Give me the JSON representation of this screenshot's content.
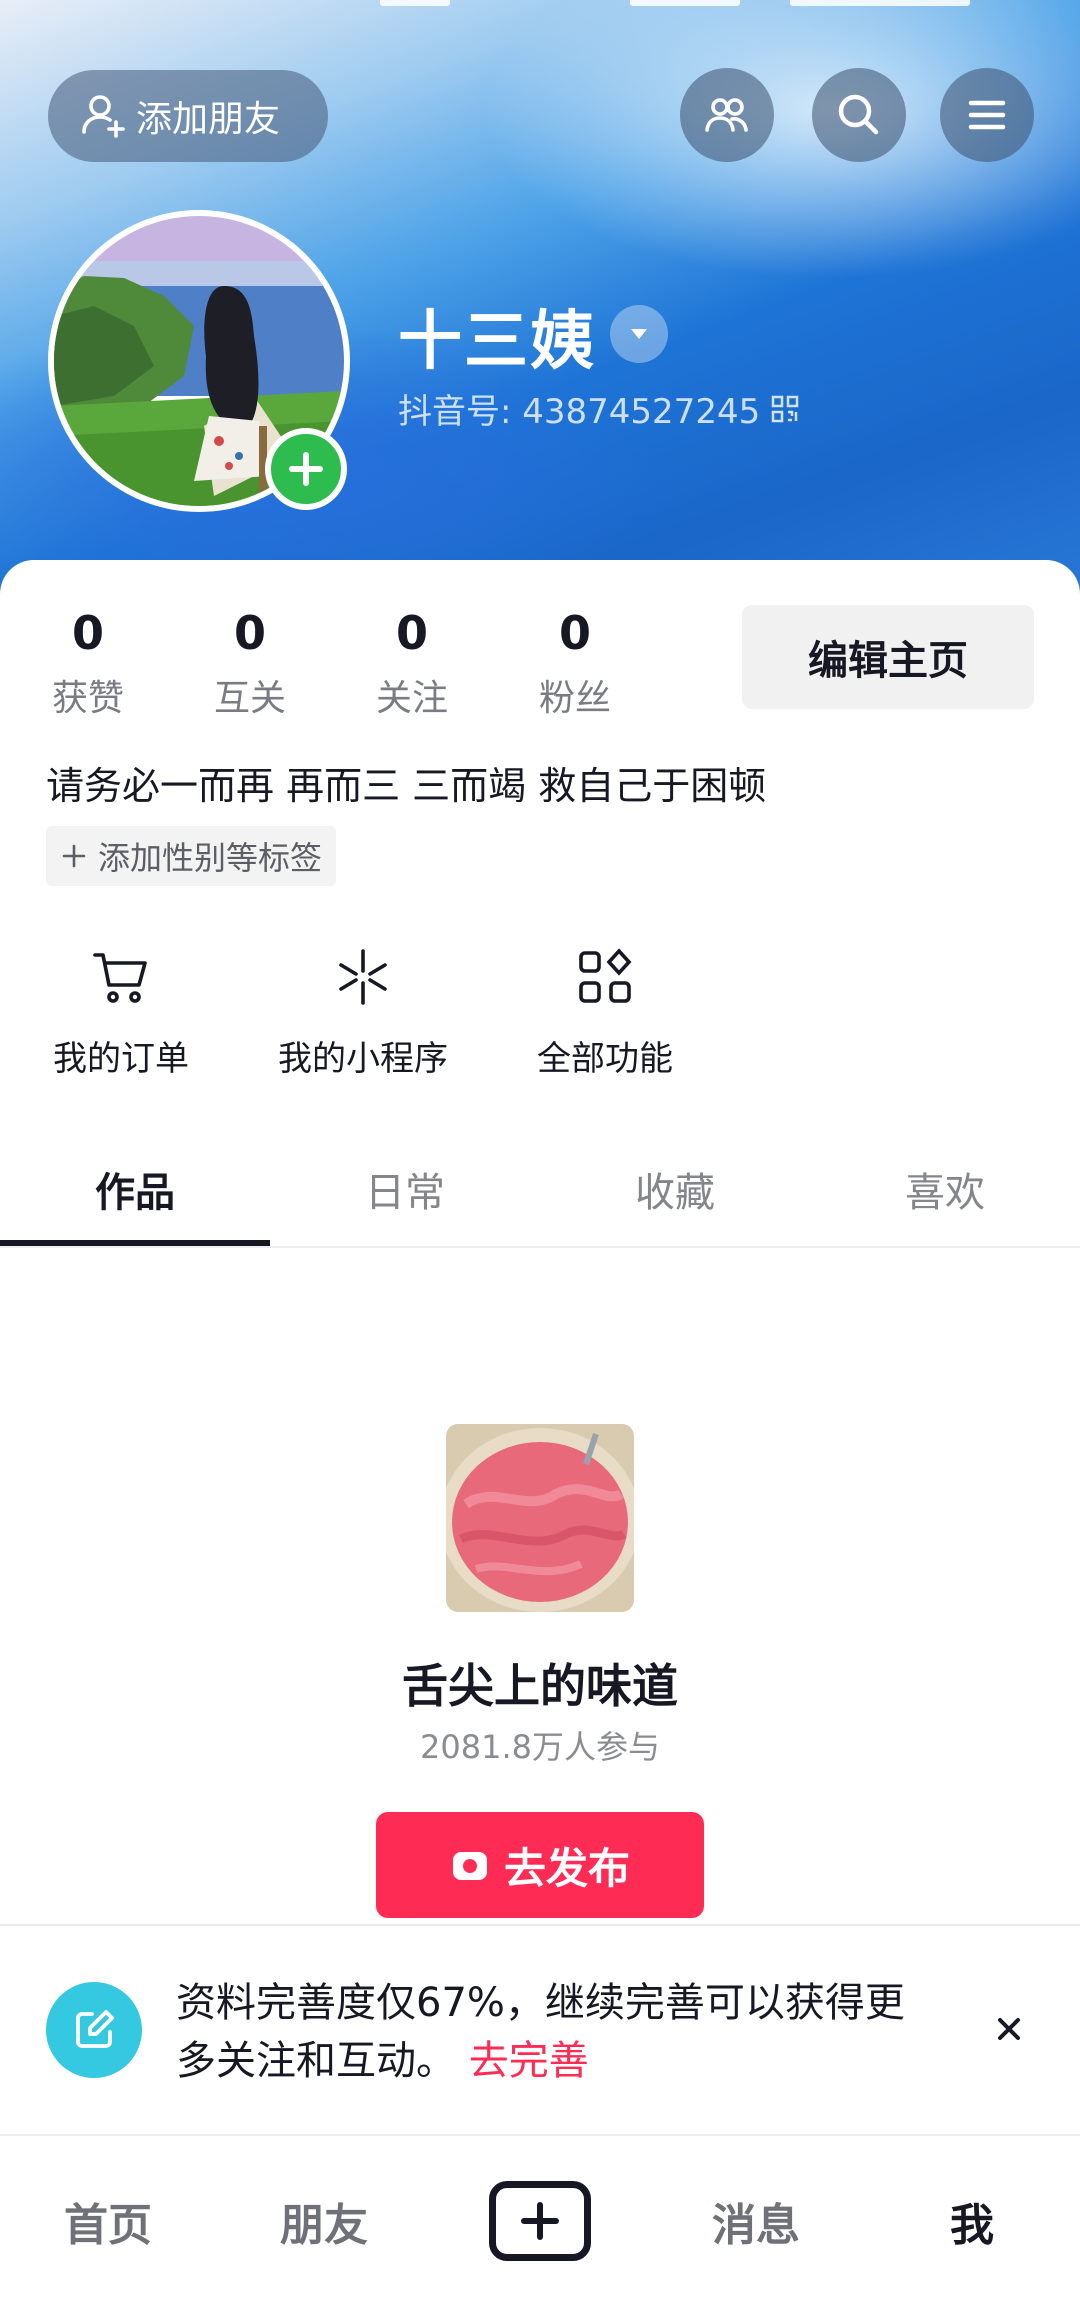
{
  "header": {
    "add_friend_label": "添加朋友",
    "username": "十三姨",
    "douyin_id": "抖音号: 43874527245",
    "icons": [
      "add-user-icon",
      "friends-icon",
      "search-icon",
      "menu-icon",
      "dropdown-icon",
      "qrcode-icon"
    ]
  },
  "stats": [
    {
      "value": "0",
      "label": "获赞"
    },
    {
      "value": "0",
      "label": "互关"
    },
    {
      "value": "0",
      "label": "关注"
    },
    {
      "value": "0",
      "label": "粉丝"
    }
  ],
  "edit_profile_label": "编辑主页",
  "bio": "请务必一而再 再而三 三而竭 救自己于困顿",
  "add_tag_label": "添加性别等标签",
  "tools": [
    {
      "label": "我的订单",
      "icon": "cart-icon"
    },
    {
      "label": "我的小程序",
      "icon": "mini-program-icon"
    },
    {
      "label": "全部功能",
      "icon": "grid-icon"
    }
  ],
  "tabs": [
    {
      "label": "作品",
      "active": true
    },
    {
      "label": "日常",
      "active": false
    },
    {
      "label": "收藏",
      "active": false
    },
    {
      "label": "喜欢",
      "active": false
    }
  ],
  "empty_state": {
    "title": "舌尖上的味道",
    "participants": "2081.8万人参与",
    "publish_label": "去发布"
  },
  "banner": {
    "text": "资料完善度仅67%，继续完善可以获得更多关注和互动。",
    "link": "去完善"
  },
  "bottom_nav": [
    {
      "label": "首页",
      "active": false
    },
    {
      "label": "朋友",
      "active": false
    },
    {
      "label": "",
      "active": false
    },
    {
      "label": "消息",
      "active": false
    },
    {
      "label": "我",
      "active": true
    }
  ],
  "colors": {
    "accent": "#fe2c55",
    "plus_badge": "#2ebc4f",
    "banner_icon": "#34c9e0",
    "header_blue": "#1a66c9"
  }
}
